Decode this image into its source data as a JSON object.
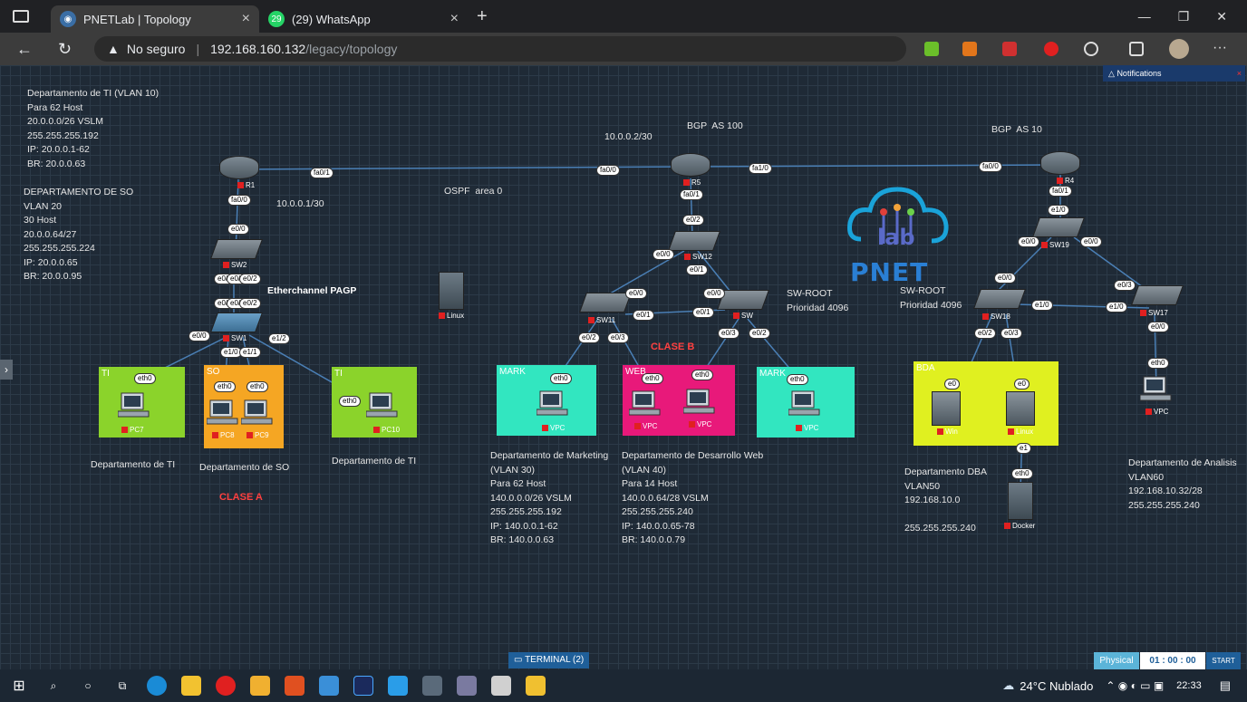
{
  "tabs": [
    {
      "title": "PNETLab | Topology",
      "active": true
    },
    {
      "title": "(29) WhatsApp",
      "active": false,
      "badge": "29"
    }
  ],
  "address": {
    "insecure": "No seguro",
    "host": "192.168.160.132",
    "path": "/legacy/topology"
  },
  "window_controls": {
    "minimize": "—",
    "restore": "❐",
    "close": "✕"
  },
  "notifications": {
    "label": "Notifications",
    "close": "×"
  },
  "annotations": {
    "ti_block": "Departamento de TI (VLAN 10)\nPara 62 Host\n20.0.0.0/26 VSLM\n255.255.255.192\nIP: 20.0.0.1-62\nBR: 20.0.0.63",
    "so_block": "DEPARTAMENTO DE SO\nVLAN 20\n30 Host\n20.0.0.64/27\n255.255.255.224\nIP: 20.0.0.65\nBR: 20.0.0.95",
    "link_10_1": "10.0.0.1/30",
    "link_10_2": "10.0.0.2/30",
    "ospf": "OSPF  area 0",
    "bgp100": "BGP  AS 100",
    "bgp10": "BGP  AS 10",
    "etherchannel": "Etherchannel PAGP",
    "swroot1": "SW-ROOT\nPrioridad 4096",
    "swroot2": "SW-ROOT\nPrioridad 4096",
    "clase_a": "CLASE A",
    "clase_b": "CLASE B",
    "dep_ti_1": "Departamento de TI",
    "dep_so": "Departamento de SO",
    "dep_ti_2": "Departamento de TI",
    "marketing": "Departamento de Marketing\n(VLAN 30)\nPara 62 Host\n140.0.0.0/26 VSLM\n255.255.255.192\nIP: 140.0.0.1-62\nBR: 140.0.0.63",
    "desarrollo": "Departamento de Desarrollo Web\n(VLAN 40)\nPara 14 Host\n140.0.0.64/28 VSLM\n255.255.255.240\nIP: 140.0.0.65-78\nBR: 140.0.0.79",
    "dba": "Departamento DBA\nVLAN50\n192.168.10.0\n\n255.255.255.240",
    "analisis": "Departamento de Analisis\nVLAN60\n192.168.10.32/28\n255.255.255.240"
  },
  "rooms": {
    "ti1": "TI",
    "so": "SO",
    "ti2": "TI",
    "mark1": "MARK",
    "web": "WEB",
    "mark2": "MARK",
    "dba": "BDA"
  },
  "devices": {
    "r1": "R1",
    "r5": "R5",
    "r4": "R4",
    "sw2": "SW2",
    "sw1": "SW1",
    "sw12": "SW12",
    "sw11": "SW11",
    "sw": "SW",
    "sw19": "SW19",
    "sw18": "SW18",
    "sw17": "SW17",
    "pc7": "PC7",
    "pc8": "PC8",
    "pc9": "PC9",
    "pc10": "PC10",
    "vpc1": "VPC",
    "vpc2": "VPC",
    "vpc3": "VPC",
    "vpc4": "VPC",
    "vpc5": "VPC",
    "linux_srv": "Linux",
    "win": "Win",
    "linux2": "Linux",
    "docker": "Docker"
  },
  "ports": {
    "r1_fa01": "fa0/1",
    "r1_fa00": "fa0/0",
    "r5_fa00": "fa0/0",
    "r5_fa10": "fa1/0",
    "r5_fa01": "fa0/1",
    "r4_fa00": "fa0/0",
    "r4_fa01": "fa0/1",
    "sw2_e00": "e0/0",
    "sw2_p1": "e0/1",
    "sw2_p2": "e0/1",
    "sw2_p3": "e0/2",
    "sw1_p1": "e0/0",
    "sw1_p2": "e0/1",
    "sw1_p3": "e0/2",
    "sw1_e00b": "e0/0",
    "sw1_e10": "e1/0",
    "sw1_e11": "e1/1",
    "sw1_e12": "e1/2",
    "eth0": "eth0",
    "sw12_e02": "e0/2",
    "sw12_e00": "e0/0",
    "sw12_e01": "e0/1",
    "sw11_e00": "e0/0",
    "sw11_e01": "e0/1",
    "sw11_e02": "e0/2",
    "sw11_e03": "e0/3",
    "sw_e00": "e0/0",
    "sw_e01": "e0/1",
    "sw_e03": "e0/3",
    "sw_e02": "e0/2",
    "sw19_e10": "e1/0",
    "sw19_e00": "e0/0",
    "sw19_e01": "e0/0",
    "sw18_e00": "e0/0",
    "sw18_e10": "e1/0",
    "sw18_e02": "e0/2",
    "sw18_e03": "e0/3",
    "sw17_e03": "e0/3",
    "sw17_e10": "e1/0",
    "sw17_e00": "e0/0",
    "e0": "e0",
    "e1": "e1"
  },
  "bottom": {
    "terminal": "TERMINAL (2)",
    "physical": "Physical",
    "timer": "01 : 00 : 00",
    "start": "START"
  },
  "taskbar": {
    "weather": "24°C  Nublado",
    "time": "22:33"
  },
  "logo": {
    "text1": "lab",
    "text2": "PNET"
  },
  "colors": {
    "grid_bg": "#1f2a36",
    "ti": "#8bd32b",
    "so": "#f5a623",
    "mark": "#32e6c0",
    "web": "#e8197a",
    "dba": "#e0f020"
  }
}
